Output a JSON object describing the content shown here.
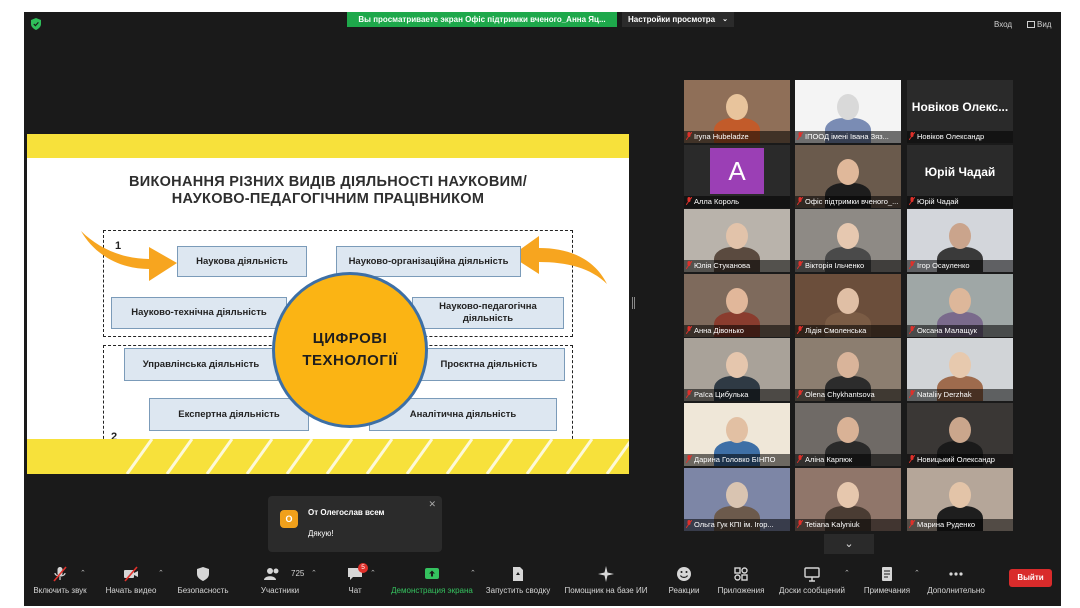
{
  "topbar": {
    "share_banner": "Вы просматриваете экран Офіс підтримки вченого_Анна Яц...",
    "view_settings": "Настройки просмотра",
    "enter": "Вход",
    "view": "Вид"
  },
  "slide": {
    "title_line1": "ВИКОНАННЯ РІЗНИХ ВИДІВ ДІЯЛЬНОСТІ НАУКОВИМ/",
    "title_line2": "НАУКОВО-ПЕДАГОГІЧНИМ ПРАЦІВНИКОМ",
    "group1_number": "1",
    "group2_number": "2",
    "center_line1": "ЦИФРОВІ",
    "center_line2": "ТЕХНОЛОГІЇ",
    "activities": [
      "Наукова діяльність",
      "Науково-організаційна діяльність",
      "Науково-технічна діяльність",
      "Науково-педагогічна діяльність",
      "Управлінська діяльність",
      "Проєктна діяльність",
      "Експертна діяльність",
      "Аналітична діяльність"
    ]
  },
  "gallery": {
    "tiles": [
      {
        "name": "Iryna Hubeladze"
      },
      {
        "name": "ІПООД імені Івана Зяз..."
      },
      {
        "name": "Новіков Олександр",
        "big_name": "Новіков Олекс..."
      },
      {
        "name": "Алла Король",
        "avatar_letter": "A"
      },
      {
        "name": "Офіс підтримки вченого_..."
      },
      {
        "name": "Юрій Чадай",
        "big_name": "Юрій Чадай"
      },
      {
        "name": "Юлія Стуканова"
      },
      {
        "name": "Вікторія Ільченко"
      },
      {
        "name": "Ігор Осауленко"
      },
      {
        "name": "Анна Дівонько"
      },
      {
        "name": "Лідія Смоленська"
      },
      {
        "name": "Оксана Малащук"
      },
      {
        "name": "Раїса Цибулька"
      },
      {
        "name": "Olena Chykhantsova"
      },
      {
        "name": "Nataliiy Derzhak"
      },
      {
        "name": "Дарина Головко БІНПО"
      },
      {
        "name": "Аліна Карпюк"
      },
      {
        "name": "Новицький Олександр"
      },
      {
        "name": "Ольга Гук КПІ ім. Ігор..."
      },
      {
        "name": "Tetiana Kalyniuk"
      },
      {
        "name": "Марина Руденко"
      }
    ],
    "scroll_down": "⌄"
  },
  "chat_toast": {
    "avatar_letter": "O",
    "from": "От Олегослав всем",
    "message": "Дякую!",
    "close": "✕"
  },
  "toolbar": {
    "unmute": "Включить звук",
    "start_video": "Начать видео",
    "security": "Безопасность",
    "participants": "Участники",
    "participants_count": "725",
    "chat": "Чат",
    "chat_badge": "5",
    "share_screen": "Демонстрация экрана",
    "summary": "Запустить сводку",
    "ai_assistant": "Помощник на базе ИИ",
    "reactions": "Реакции",
    "apps": "Приложения",
    "whiteboards": "Доски сообщений",
    "notes": "Примечания",
    "more": "Дополнительно",
    "leave": "Выйти"
  },
  "colors": {
    "share_green": "#1ea84b",
    "slide_yellow": "#f7e13b",
    "circle_orange": "#fbb414",
    "leave_red": "#d92b2b",
    "active_speaker": "#c8df3b"
  }
}
